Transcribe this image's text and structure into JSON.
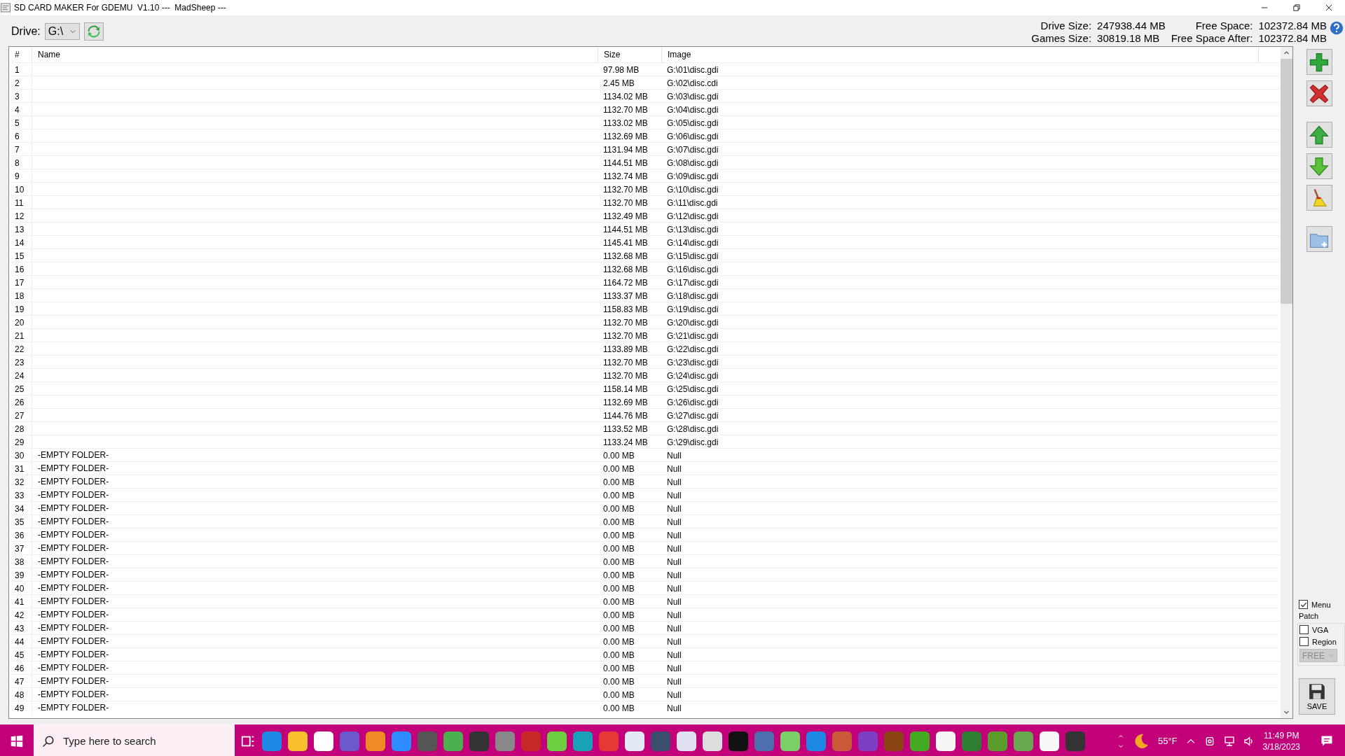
{
  "window": {
    "title": "SD CARD MAKER For GDEMU  V1.10 ---  MadSheep ---"
  },
  "drive": {
    "label": "Drive:",
    "value": "G:\\"
  },
  "stats": {
    "drive_size_label": "Drive Size:",
    "drive_size": "247938.44 MB",
    "free_space_label": "Free Space:",
    "free_space": "102372.84 MB",
    "games_size_label": "Games Size:",
    "games_size": "30819.18 MB",
    "free_after_label": "Free Space After:",
    "free_after": "102372.84 MB"
  },
  "table": {
    "columns": [
      "#",
      "Name",
      "Size",
      "Image"
    ],
    "rows": [
      {
        "n": "1",
        "size": "97.98 MB",
        "image": "G:\\01\\disc.gdi"
      },
      {
        "n": "2",
        "size": "2.45 MB",
        "image": "G:\\02\\disc.cdi"
      },
      {
        "n": "3",
        "size": "1134.02 MB",
        "image": "G:\\03\\disc.gdi"
      },
      {
        "n": "4",
        "size": "1132.70 MB",
        "image": "G:\\04\\disc.gdi"
      },
      {
        "n": "5",
        "size": "1133.02 MB",
        "image": "G:\\05\\disc.gdi"
      },
      {
        "n": "6",
        "size": "1132.69 MB",
        "image": "G:\\06\\disc.gdi"
      },
      {
        "n": "7",
        "size": "1131.94 MB",
        "image": "G:\\07\\disc.gdi"
      },
      {
        "n": "8",
        "size": "1144.51 MB",
        "image": "G:\\08\\disc.gdi"
      },
      {
        "n": "9",
        "size": "1132.74 MB",
        "image": "G:\\09\\disc.gdi"
      },
      {
        "n": "10",
        "size": "1132.70 MB",
        "image": "G:\\10\\disc.gdi"
      },
      {
        "n": "11",
        "size": "1132.70 MB",
        "image": "G:\\11\\disc.gdi"
      },
      {
        "n": "12",
        "size": "1132.49 MB",
        "image": "G:\\12\\disc.gdi"
      },
      {
        "n": "13",
        "size": "1144.51 MB",
        "image": "G:\\13\\disc.gdi"
      },
      {
        "n": "14",
        "size": "1145.41 MB",
        "image": "G:\\14\\disc.gdi"
      },
      {
        "n": "15",
        "size": "1132.68 MB",
        "image": "G:\\15\\disc.gdi"
      },
      {
        "n": "16",
        "size": "1132.68 MB",
        "image": "G:\\16\\disc.gdi"
      },
      {
        "n": "17",
        "size": "1164.72 MB",
        "image": "G:\\17\\disc.gdi"
      },
      {
        "n": "18",
        "size": "1133.37 MB",
        "image": "G:\\18\\disc.gdi"
      },
      {
        "n": "19",
        "size": "1158.83 MB",
        "image": "G:\\19\\disc.gdi"
      },
      {
        "n": "20",
        "size": "1132.70 MB",
        "image": "G:\\20\\disc.gdi"
      },
      {
        "n": "21",
        "size": "1132.70 MB",
        "image": "G:\\21\\disc.gdi"
      },
      {
        "n": "22",
        "size": "1133.89 MB",
        "image": "G:\\22\\disc.gdi"
      },
      {
        "n": "23",
        "size": "1132.70 MB",
        "image": "G:\\23\\disc.gdi"
      },
      {
        "n": "24",
        "size": "1132.70 MB",
        "image": "G:\\24\\disc.gdi"
      },
      {
        "n": "25",
        "size": "1158.14 MB",
        "image": "G:\\25\\disc.gdi"
      },
      {
        "n": "26",
        "size": "1132.69 MB",
        "image": "G:\\26\\disc.gdi"
      },
      {
        "n": "27",
        "size": "1144.76 MB",
        "image": "G:\\27\\disc.gdi"
      },
      {
        "n": "28",
        "size": "1133.52 MB",
        "image": "G:\\28\\disc.gdi"
      },
      {
        "n": "29",
        "size": "1133.24 MB",
        "image": "G:\\29\\disc.gdi"
      },
      {
        "n": "30",
        "name": "-EMPTY FOLDER-",
        "size": "0.00 MB",
        "image": "Null"
      },
      {
        "n": "31",
        "name": "-EMPTY FOLDER-",
        "size": "0.00 MB",
        "image": "Null"
      },
      {
        "n": "32",
        "name": "-EMPTY FOLDER-",
        "size": "0.00 MB",
        "image": "Null"
      },
      {
        "n": "33",
        "name": "-EMPTY FOLDER-",
        "size": "0.00 MB",
        "image": "Null"
      },
      {
        "n": "34",
        "name": "-EMPTY FOLDER-",
        "size": "0.00 MB",
        "image": "Null"
      },
      {
        "n": "35",
        "name": "-EMPTY FOLDER-",
        "size": "0.00 MB",
        "image": "Null"
      },
      {
        "n": "36",
        "name": "-EMPTY FOLDER-",
        "size": "0.00 MB",
        "image": "Null"
      },
      {
        "n": "37",
        "name": "-EMPTY FOLDER-",
        "size": "0.00 MB",
        "image": "Null"
      },
      {
        "n": "38",
        "name": "-EMPTY FOLDER-",
        "size": "0.00 MB",
        "image": "Null"
      },
      {
        "n": "39",
        "name": "-EMPTY FOLDER-",
        "size": "0.00 MB",
        "image": "Null"
      },
      {
        "n": "40",
        "name": "-EMPTY FOLDER-",
        "size": "0.00 MB",
        "image": "Null"
      },
      {
        "n": "41",
        "name": "-EMPTY FOLDER-",
        "size": "0.00 MB",
        "image": "Null"
      },
      {
        "n": "42",
        "name": "-EMPTY FOLDER-",
        "size": "0.00 MB",
        "image": "Null"
      },
      {
        "n": "43",
        "name": "-EMPTY FOLDER-",
        "size": "0.00 MB",
        "image": "Null"
      },
      {
        "n": "44",
        "name": "-EMPTY FOLDER-",
        "size": "0.00 MB",
        "image": "Null"
      },
      {
        "n": "45",
        "name": "-EMPTY FOLDER-",
        "size": "0.00 MB",
        "image": "Null"
      },
      {
        "n": "46",
        "name": "-EMPTY FOLDER-",
        "size": "0.00 MB",
        "image": "Null"
      },
      {
        "n": "47",
        "name": "-EMPTY FOLDER-",
        "size": "0.00 MB",
        "image": "Null"
      },
      {
        "n": "48",
        "name": "-EMPTY FOLDER-",
        "size": "0.00 MB",
        "image": "Null"
      },
      {
        "n": "49",
        "name": "-EMPTY FOLDER-",
        "size": "0.00 MB",
        "image": "Null"
      }
    ]
  },
  "options": {
    "menu": {
      "label": "Menu",
      "checked": true
    },
    "patch_label": "Patch",
    "vga": {
      "label": "VGA",
      "checked": false
    },
    "region": {
      "label": "Region",
      "checked": false
    },
    "region_select": {
      "value": "FREE",
      "disabled": true
    },
    "save_label": "SAVE"
  },
  "taskbar": {
    "search_placeholder": "Type here to search",
    "weather": "55°F",
    "time": "11:49 PM",
    "date": "3/18/2023"
  }
}
